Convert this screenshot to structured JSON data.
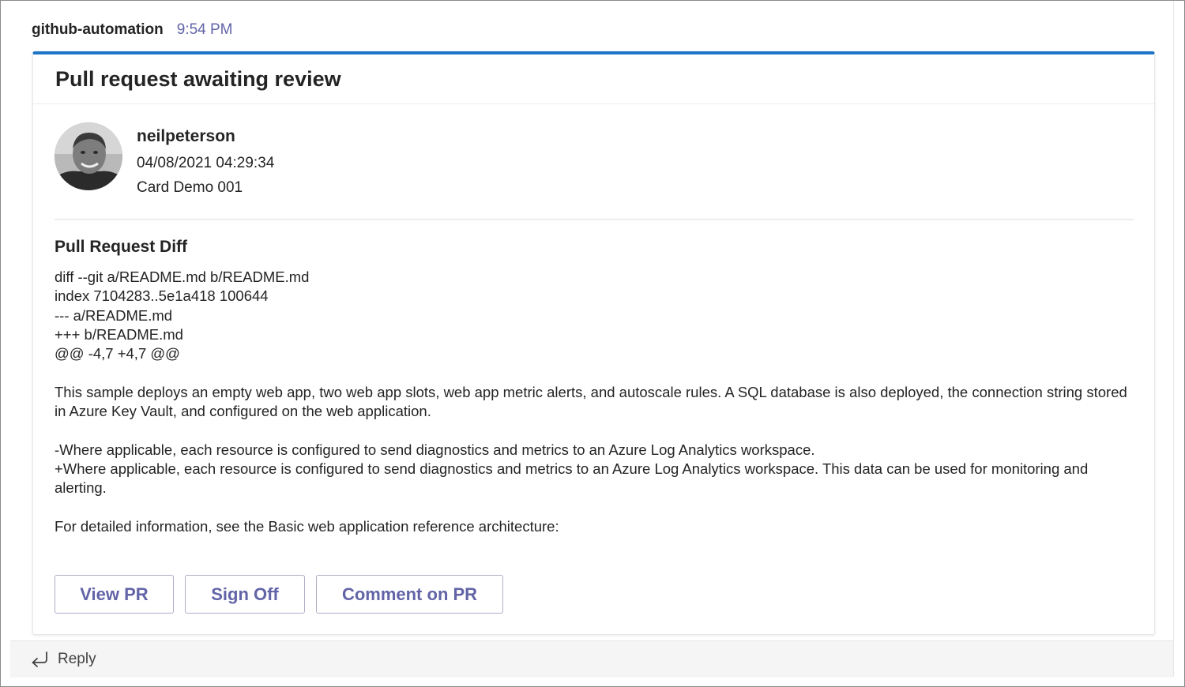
{
  "message": {
    "sender": "github-automation",
    "time": "9:54 PM"
  },
  "card": {
    "title": "Pull request awaiting review",
    "author": {
      "name": "neilpeterson",
      "date": "04/08/2021 04:29:34",
      "subtitle": "Card Demo 001",
      "avatar_icon": "user-avatar-photo"
    },
    "diff": {
      "heading": "Pull Request Diff",
      "header_lines": [
        "diff --git a/README.md b/README.md",
        "index 7104283..5e1a418 100644",
        "--- a/README.md",
        "+++ b/README.md",
        "@@ -4,7 +4,7 @@"
      ],
      "paragraph_1": "This sample deploys an empty web app, two web app slots, web app metric alerts, and autoscale rules. A SQL database is also deployed, the connection string stored in Azure Key Vault, and configured on the web application.",
      "removed_line": "-Where applicable, each resource is configured to send diagnostics and metrics to an Azure Log Analytics workspace.",
      "added_line": "+Where applicable, each resource is configured to send diagnostics and metrics to an Azure Log Analytics workspace. This data can be used for monitoring and alerting.",
      "paragraph_last": "For detailed information, see the Basic web application reference architecture:"
    },
    "actions": {
      "view_pr": "View PR",
      "sign_off": "Sign Off",
      "comment": "Comment on PR"
    }
  },
  "reply": {
    "label": "Reply",
    "icon": "reply-arrow-icon"
  },
  "colors": {
    "accent": "#1e74c6",
    "button_text": "#6264a7",
    "timestamp": "#6264a7"
  }
}
